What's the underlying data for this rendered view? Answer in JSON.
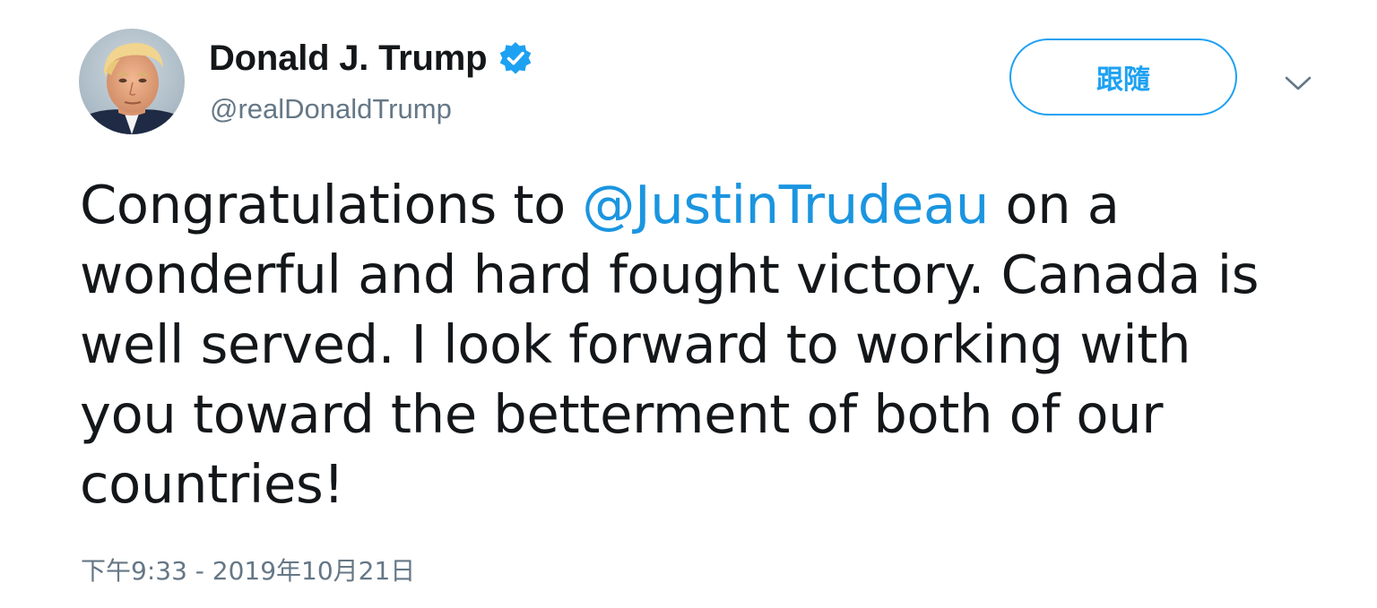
{
  "author": {
    "display_name": "Donald J. Trump",
    "handle": "@realDonaldTrump",
    "verified": true,
    "avatar_icon": "profile-photo"
  },
  "actions": {
    "follow_label": "跟隨",
    "more_icon": "chevron-down-icon"
  },
  "tweet": {
    "lines": [
      {
        "before": "Congratulations to ",
        "mention": "@JustinTrudeau",
        "after": " on a"
      },
      {
        "text": "wonderful and hard fought victory. Canada is"
      },
      {
        "text": "well served. I look forward to working with"
      },
      {
        "text": "you toward the betterment of both of our"
      },
      {
        "text": "countries!"
      }
    ],
    "timestamp": "下午9:33 - 2019年10月21日"
  },
  "colors": {
    "accent": "#1da1f2",
    "mention": "#1b95e0",
    "text": "#14171a",
    "secondary_text": "#657786",
    "background": "#ffffff"
  }
}
